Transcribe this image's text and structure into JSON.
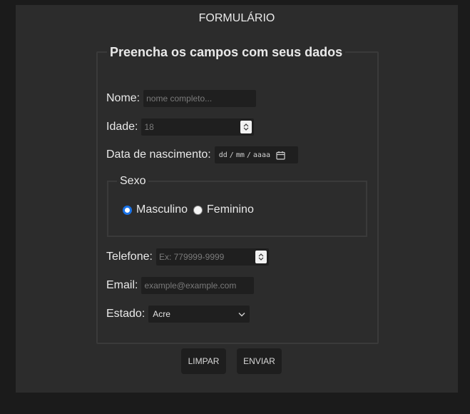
{
  "header": {
    "title": "FORMULÁRIO"
  },
  "form": {
    "legend": "Preencha os campos com seus dados",
    "nome": {
      "label": "Nome:",
      "placeholder": "nome completo..."
    },
    "idade": {
      "label": "Idade:",
      "placeholder": "18"
    },
    "nascimento": {
      "label": "Data de nascimento:",
      "dd": "dd",
      "mm": "mm",
      "aaaa": "aaaa",
      "sep": "/"
    },
    "sexo": {
      "legend": "Sexo",
      "options": [
        {
          "label": "Masculino",
          "checked": true
        },
        {
          "label": "Feminino",
          "checked": false
        }
      ]
    },
    "telefone": {
      "label": "Telefone:",
      "placeholder": "Ex: 779999-9999"
    },
    "email": {
      "label": "Email:",
      "placeholder": "example@example.com"
    },
    "estado": {
      "label": "Estado:",
      "selected": "Acre"
    }
  },
  "buttons": {
    "clear": "LIMPAR",
    "submit": "ENVIAR"
  },
  "colors": {
    "radio_accent": "#1a73e8",
    "panel_bg": "#2c2c2c",
    "page_bg": "#1b1b1b"
  }
}
